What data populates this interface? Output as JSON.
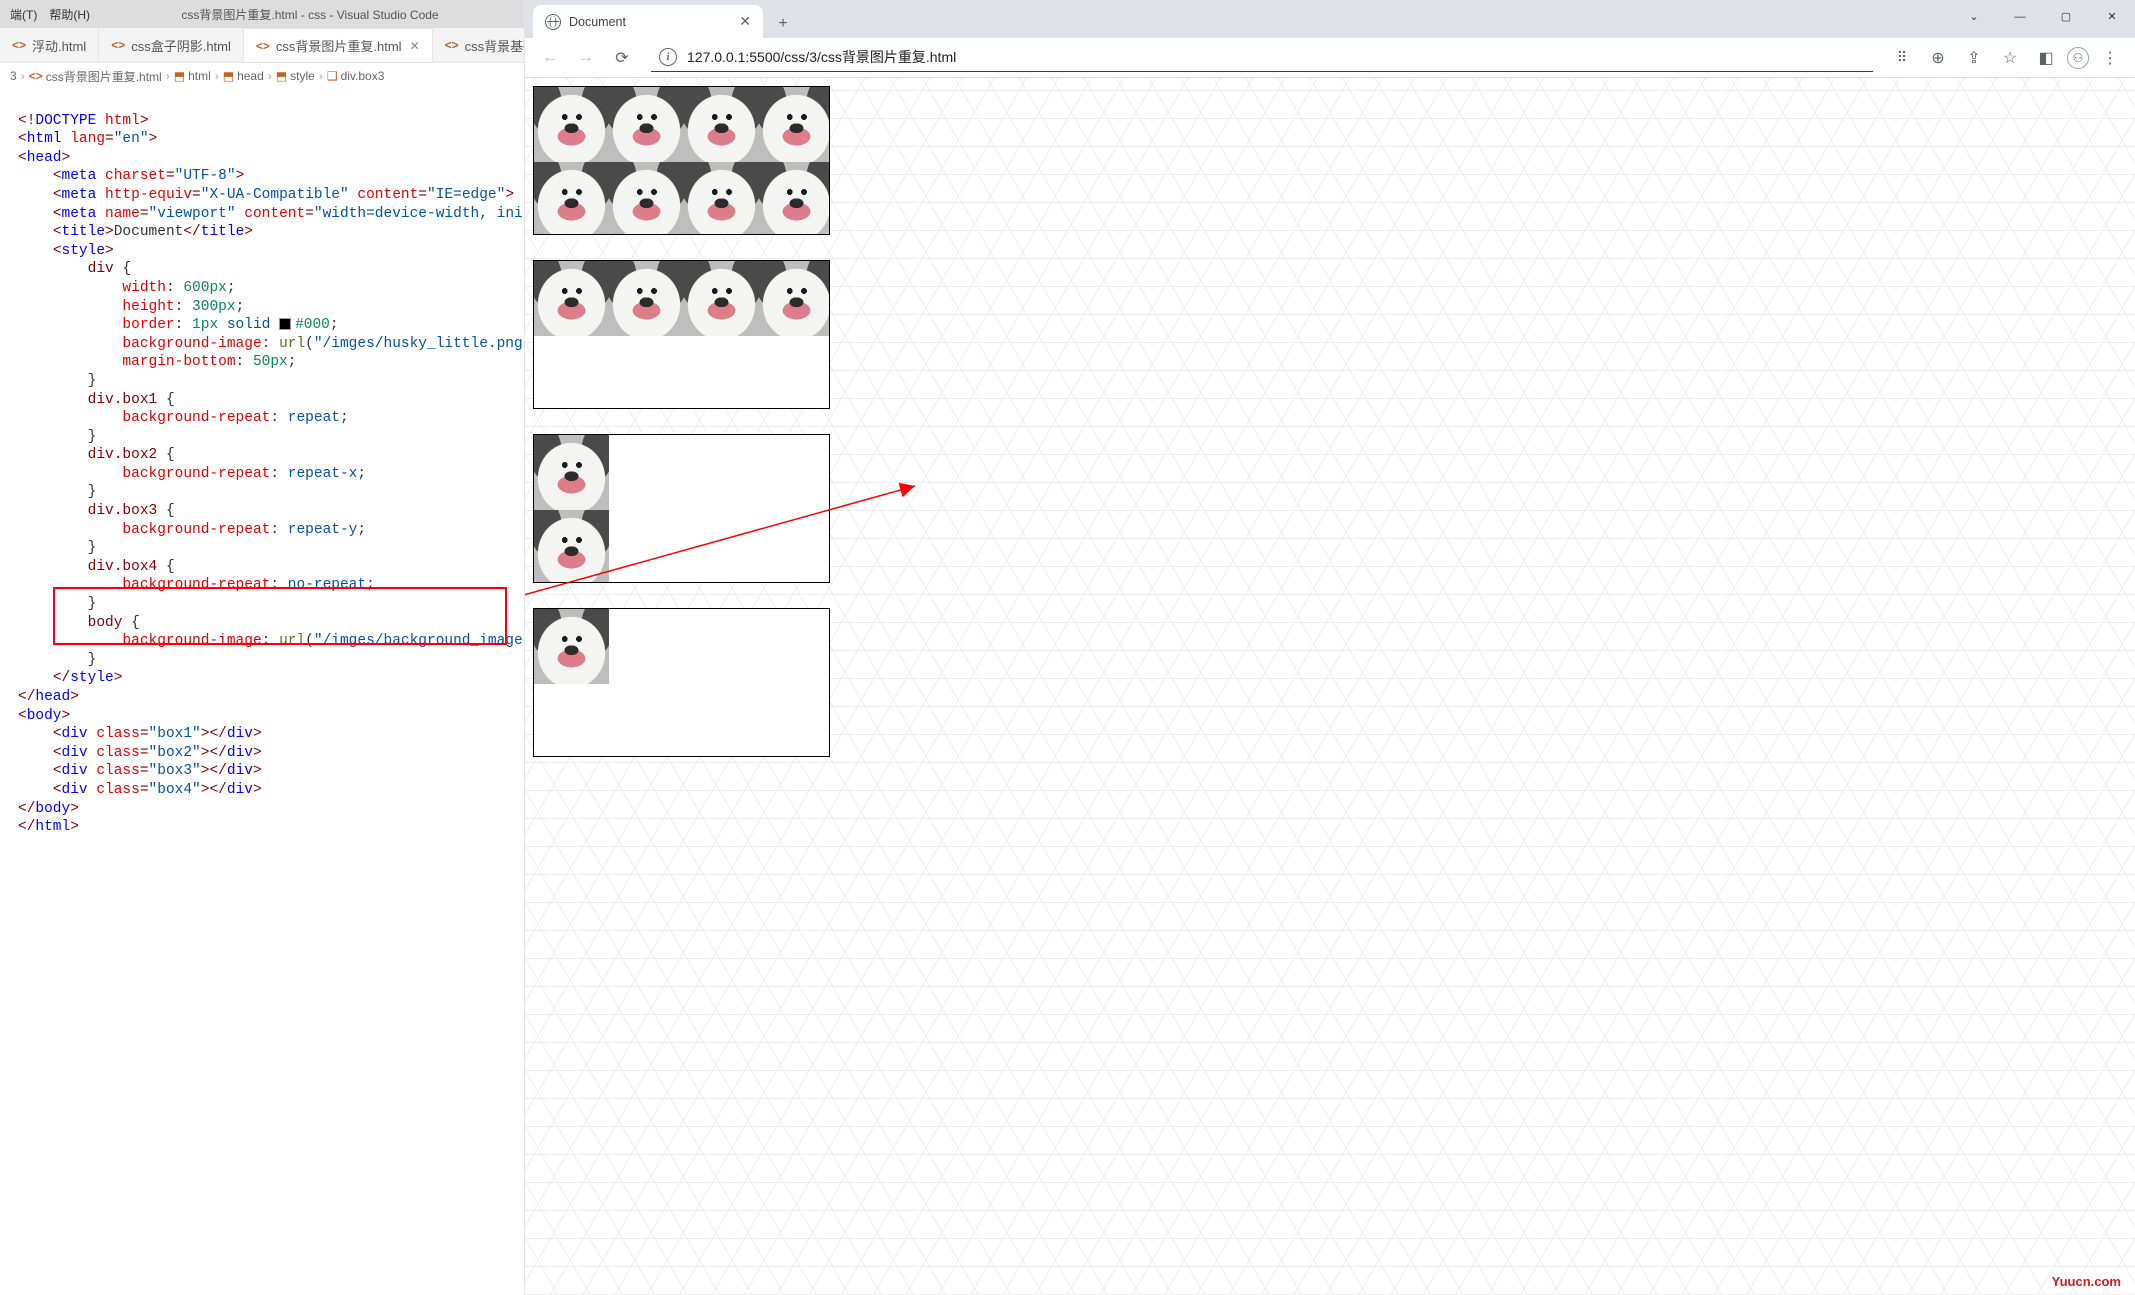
{
  "vscode": {
    "menu": {
      "terminal": "端(T)",
      "help": "帮助(H)"
    },
    "title": "css背景图片重复.html - css - Visual Studio Code",
    "tabs": [
      {
        "label": "浮动.html",
        "active": false
      },
      {
        "label": "css盒子阴影.html",
        "active": false
      },
      {
        "label": "css背景图片重复.html",
        "active": true
      },
      {
        "label": "css背景基础知",
        "active": false
      }
    ],
    "breadcrumb": [
      "3",
      "css背景图片重复.html",
      "html",
      "head",
      "style",
      "div.box3"
    ],
    "code": {
      "c01": "<!DOCTYPE html>",
      "c02": "<html lang=\"en\">",
      "c03": "<head>",
      "c04": "    <meta charset=\"UTF-8\">",
      "c05": "    <meta http-equiv=\"X-UA-Compatible\" content=\"IE=edge\">",
      "c06": "    <meta name=\"viewport\" content=\"width=device-width, initial-scal",
      "c07": "    <title>Document</title>",
      "c08": "    <style>",
      "c09": "        div {",
      "c10": "            width: 600px;",
      "c11": "            height: 300px;",
      "c12": "            border: 1px solid #000;",
      "c13": "            background-image: url(\"/imges/husky_little.png\");",
      "c14": "            margin-bottom: 50px;",
      "c15": "        }",
      "c16": "        div.box1 {",
      "c17": "            background-repeat: repeat;",
      "c18": "        }",
      "c19": "        div.box2 {",
      "c20": "            background-repeat: repeat-x;",
      "c21": "        }",
      "c22": "        div.box3 {",
      "c23": "            background-repeat: repeat-y;",
      "c24": "        }",
      "c25": "        div.box4 {",
      "c26": "            background-repeat: no-repeat;",
      "c27": "        }",
      "c28": "        body {",
      "c29": "            background-image: url(\"/imges/background_image.webp\");",
      "c30": "        }",
      "c31": "    </style>",
      "c32": "</head>",
      "c33": "<body>",
      "c34": "    <div class=\"box1\"></div>",
      "c35": "    <div class=\"box2\"></div>",
      "c36": "    <div class=\"box3\"></div>",
      "c37": "    <div class=\"box4\"></div>",
      "c38": "</body>",
      "c39": "</html>"
    }
  },
  "browser": {
    "tab": {
      "title": "Document"
    },
    "url": "127.0.0.1:5500/css/3/css背景图片重复.html",
    "newtab_tip": "+",
    "watermark": "Yuucn.com"
  }
}
